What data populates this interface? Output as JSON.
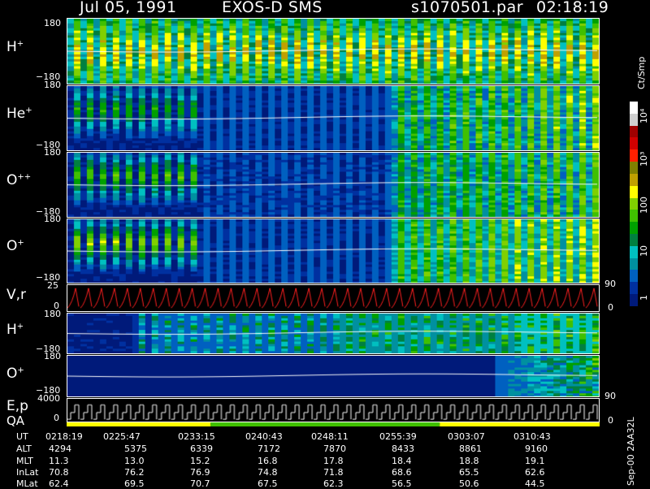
{
  "header": {
    "date": "Jul 05, 1991",
    "instrument": "EXOS-D SMS",
    "file": "s1070501.par",
    "time": "02:18:19"
  },
  "panels": [
    {
      "label": "H",
      "charge": "+",
      "ymax": "180",
      "ymin": "−180"
    },
    {
      "label": "He",
      "charge": "+",
      "ymax": "180",
      "ymin": "−180"
    },
    {
      "label": "O",
      "charge": "++",
      "ymax": "180",
      "ymin": "−180"
    },
    {
      "label": "O",
      "charge": "+",
      "ymax": "180",
      "ymin": "−180"
    },
    {
      "label": "V,r",
      "charge": "",
      "ymax": "25",
      "ymin": "0",
      "right_top": "90",
      "right_bottom": "0"
    },
    {
      "label": "H",
      "charge": "+",
      "ymax": "180",
      "ymin": "−180"
    },
    {
      "label": "O",
      "charge": "+",
      "ymax": "180",
      "ymin": "−180",
      "right_bottom": "90"
    },
    {
      "label": "E,p",
      "charge": "",
      "ymax": "4000",
      "ymin": "0",
      "right_bottom": "0"
    }
  ],
  "qa_label": "QA",
  "colorbar": {
    "unit": "Ct/Smp",
    "ticks": [
      "10⁴",
      "10³",
      "100",
      "10",
      "1"
    ],
    "colors": [
      "#ffffff",
      "#d0d0d0",
      "#a00000",
      "#d00000",
      "#ff2000",
      "#808000",
      "#c0a000",
      "#ffff00",
      "#80d000",
      "#40c000",
      "#00a000",
      "#008040",
      "#00c0c0",
      "#0090a0",
      "#0060c0",
      "#0030a0",
      "#001a7a"
    ]
  },
  "ephemeris": {
    "labels": [
      "UT",
      "ALT",
      "MLT",
      "InLat",
      "MLat"
    ],
    "columns": [
      {
        "UT": "0218:19",
        "ALT": "4294",
        "MLT": "11.3",
        "InLat": "70.8",
        "MLat": "62.4"
      },
      {
        "UT": "0225:47",
        "ALT": "5375",
        "MLT": "13.0",
        "InLat": "76.2",
        "MLat": "69.5"
      },
      {
        "UT": "0233:15",
        "ALT": "6339",
        "MLT": "15.2",
        "InLat": "76.9",
        "MLat": "70.7"
      },
      {
        "UT": "0240:43",
        "ALT": "7172",
        "MLT": "16.8",
        "InLat": "74.8",
        "MLat": "67.5"
      },
      {
        "UT": "0248:11",
        "ALT": "7870",
        "MLT": "17.8",
        "InLat": "71.8",
        "MLat": "62.3"
      },
      {
        "UT": "0255:39",
        "ALT": "8433",
        "MLT": "18.4",
        "InLat": "68.6",
        "MLat": "56.5"
      },
      {
        "UT": "0303:07",
        "ALT": "8861",
        "MLT": "18.8",
        "InLat": "65.5",
        "MLat": "50.6"
      },
      {
        "UT": "0310:43",
        "ALT": "9160",
        "MLT": "19.1",
        "InLat": "62.6",
        "MLat": "44.5"
      }
    ]
  },
  "footer_note": "Sep-00 2AA32L",
  "chart_data": {
    "type": "heatmap",
    "x_ticks": [
      "0218:19",
      "0225:47",
      "0233:15",
      "0240:43",
      "0248:11",
      "0255:39",
      "0303:07",
      "0310:43"
    ],
    "pitch_angle_range": [
      -180,
      180
    ],
    "velocity_range": [
      0,
      25
    ],
    "energy_range": [
      0,
      4000
    ],
    "color_scale": "log",
    "color_range": [
      1,
      10000
    ]
  }
}
